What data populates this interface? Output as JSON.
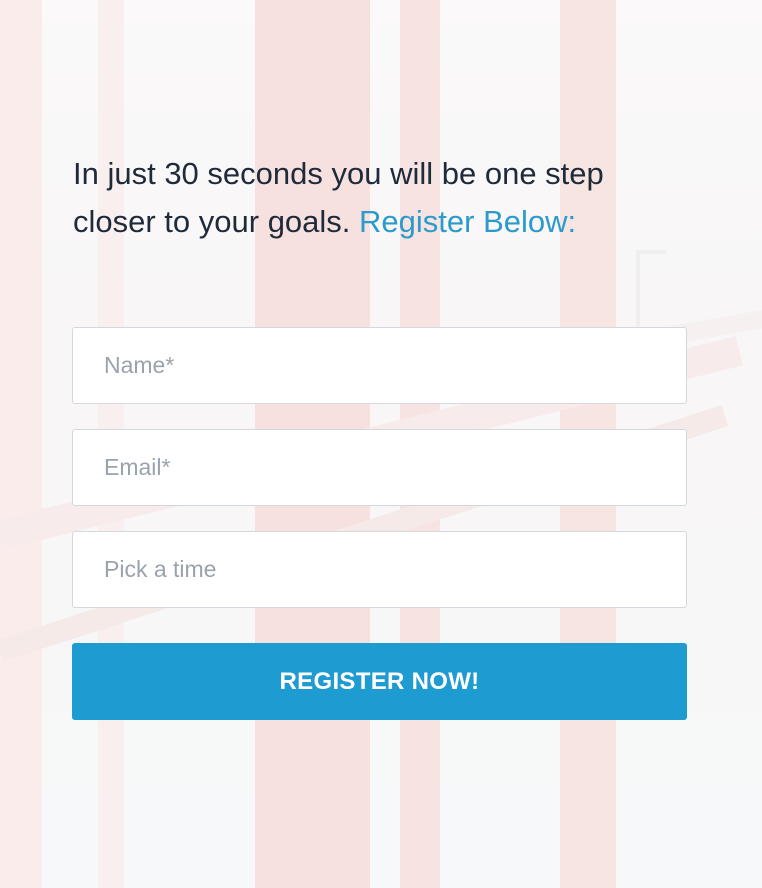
{
  "headline": {
    "text": "In just 30 seconds you will be one step closer to your goals.",
    "accent": "Register Below:"
  },
  "form": {
    "name_placeholder": "Name*",
    "email_placeholder": "Email*",
    "time_placeholder": "Pick a time",
    "submit_label": "REGISTER NOW!"
  },
  "colors": {
    "accent": "#2a9bcb",
    "button": "#1e9bd0",
    "text": "#1f2a3a",
    "placeholder": "#9aa3ad"
  },
  "background": {
    "description_icon": "golden-gate-bridge-image"
  }
}
